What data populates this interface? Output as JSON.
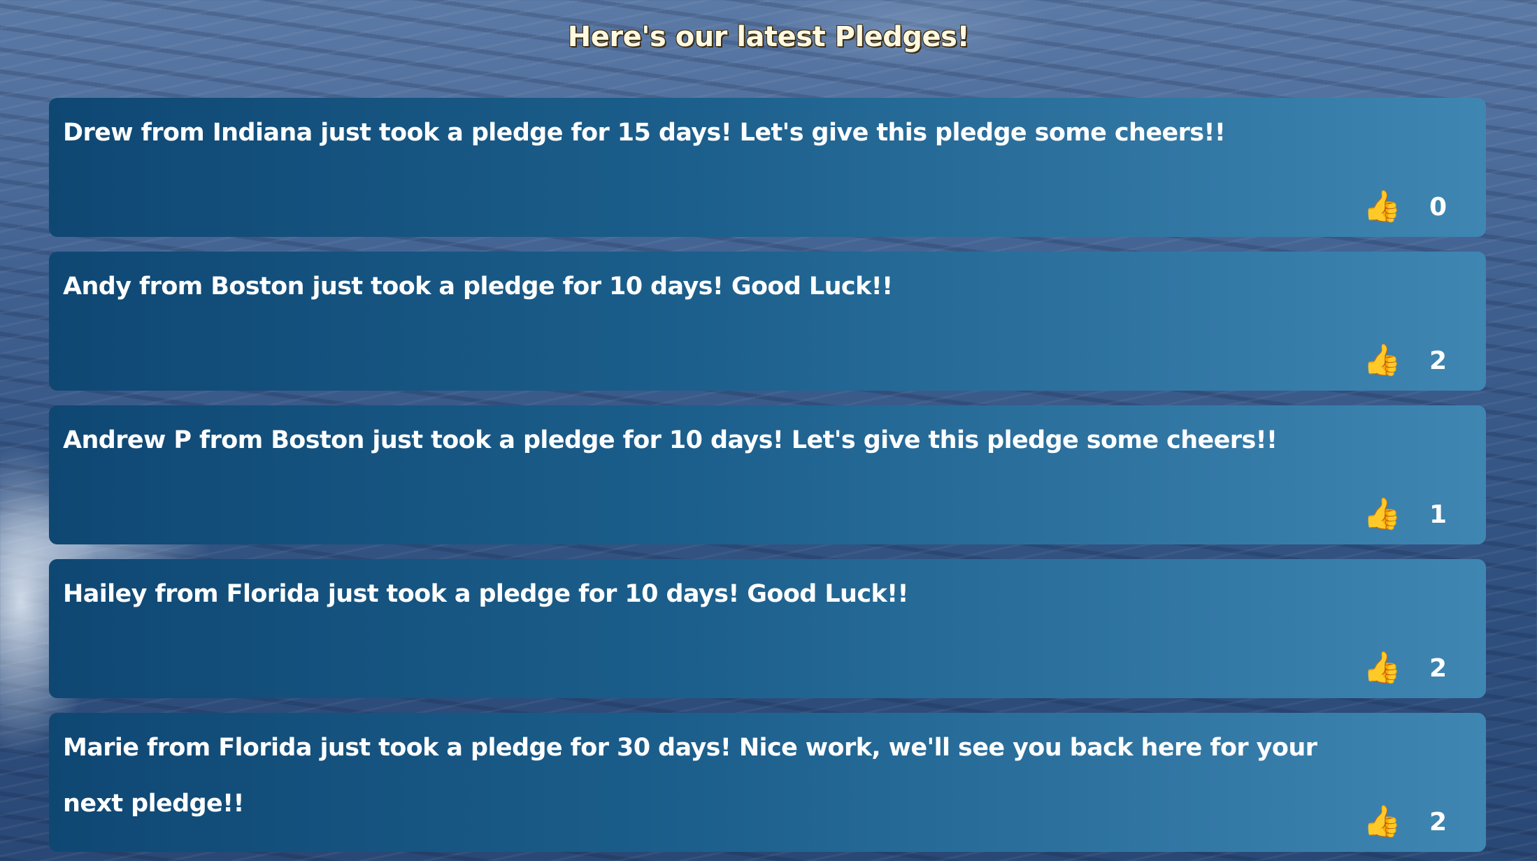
{
  "page": {
    "title": "Here's our latest Pledges!"
  },
  "pledges": [
    {
      "text": "Drew from Indiana just took a pledge for 15 days! Let's give this pledge some cheers!!",
      "cheers": "0",
      "icon": "thumbs-up-icon"
    },
    {
      "text": "Andy from Boston just took a pledge for 10 days! Good Luck!!",
      "cheers": "2",
      "icon": "thumbs-up-icon"
    },
    {
      "text": "Andrew P from Boston just took a pledge for 10 days! Let's give this pledge some cheers!!",
      "cheers": "1",
      "icon": "thumbs-up-icon"
    },
    {
      "text": "Hailey from Florida just took a pledge for 10 days! Good Luck!!",
      "cheers": "2",
      "icon": "thumbs-up-icon"
    },
    {
      "text": "Marie from Florida just took a pledge for 30 days! Nice work, we'll see you back here for your next pledge!!",
      "cheers": "2",
      "icon": "thumbs-up-icon"
    }
  ],
  "colors": {
    "card_start": "#0f4773",
    "card_end": "#3f86b3",
    "title_text": "#fff9e0",
    "text": "#ffffff"
  }
}
